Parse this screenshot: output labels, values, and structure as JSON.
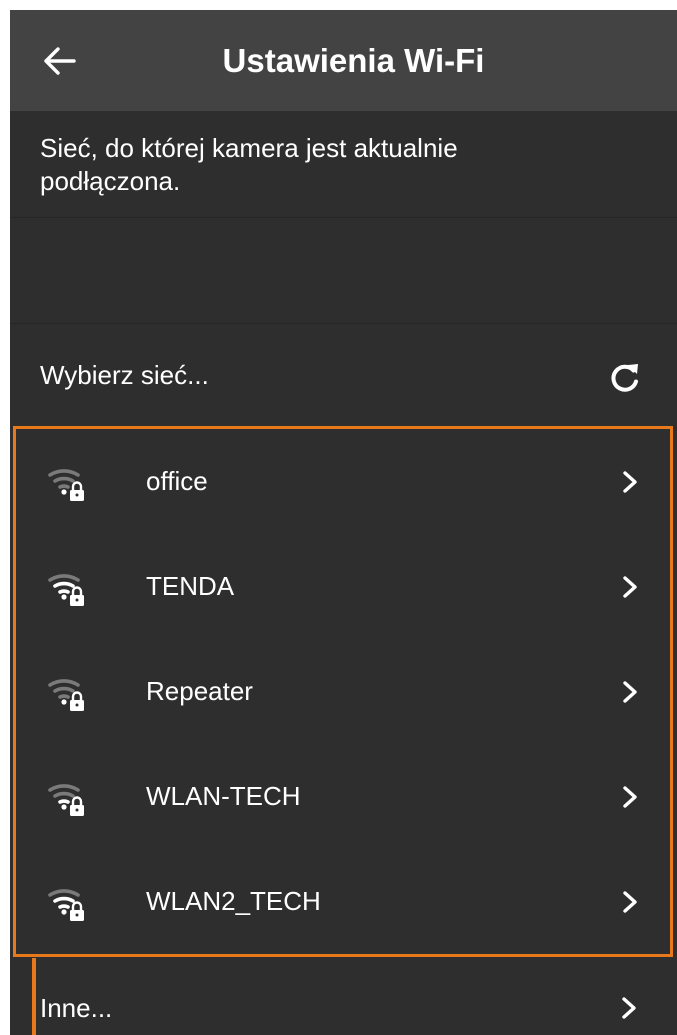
{
  "header": {
    "title": "Ustawienia Wi-Fi",
    "back_icon": "arrow-left-icon"
  },
  "current_network": {
    "description": "Sieć, do której kamera jest aktualnie podłączona."
  },
  "choose": {
    "label": "Wybierz sieć...",
    "refresh_icon": "refresh-icon"
  },
  "networks": [
    {
      "name": "office",
      "icon": "wifi-locked-icon",
      "signal_level": 0.25
    },
    {
      "name": "TENDA",
      "icon": "wifi-locked-icon",
      "signal_level": 0.75
    },
    {
      "name": "Repeater",
      "icon": "wifi-locked-icon",
      "signal_level": 0.25
    },
    {
      "name": "WLAN-TECH",
      "icon": "wifi-locked-icon",
      "signal_level": 0.5
    },
    {
      "name": "WLAN2_TECH",
      "icon": "wifi-locked-icon",
      "signal_level": 0.75
    }
  ],
  "other": {
    "label": "Inne..."
  },
  "colors": {
    "header_bg": "#434343",
    "body_bg": "#2e2e2e",
    "highlight": "#e8781c",
    "text": "#ffffff"
  }
}
